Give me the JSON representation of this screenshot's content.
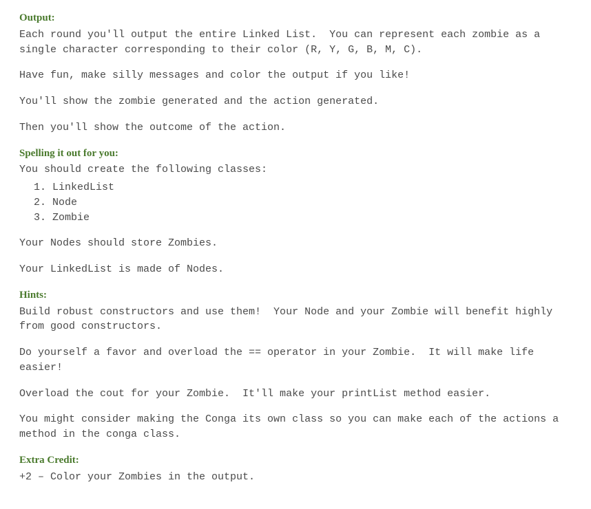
{
  "output": {
    "heading": "Output:",
    "p1": "Each round you'll output the entire Linked List.  You can represent each zombie as a single character corresponding to their color (R, Y, G, B, M, C).",
    "p2": "Have fun, make silly messages and color the output if you like!",
    "p3": "You'll show the zombie generated and the action generated.",
    "p4": "Then you'll show the outcome of the action."
  },
  "spelling": {
    "heading": "Spelling it out for you:",
    "intro": "You should create the following classes:",
    "classes": [
      "LinkedList",
      "Node",
      "Zombie"
    ],
    "p1": "Your Nodes should store Zombies.",
    "p2": "Your LinkedList is made of Nodes."
  },
  "hints": {
    "heading": "Hints:",
    "p1": "Build robust constructors and use them!  Your Node and your Zombie will benefit highly from good constructors.",
    "p2": "Do yourself a favor and overload the == operator in your Zombie.  It will make life easier!",
    "p3": "Overload the cout for your Zombie.  It'll make your printList method easier.",
    "p4": "You might consider making the Conga its own class so you can make each of the actions a method in the conga class."
  },
  "extra": {
    "heading": "Extra Credit:",
    "p1": "+2 – Color your Zombies in the output."
  }
}
